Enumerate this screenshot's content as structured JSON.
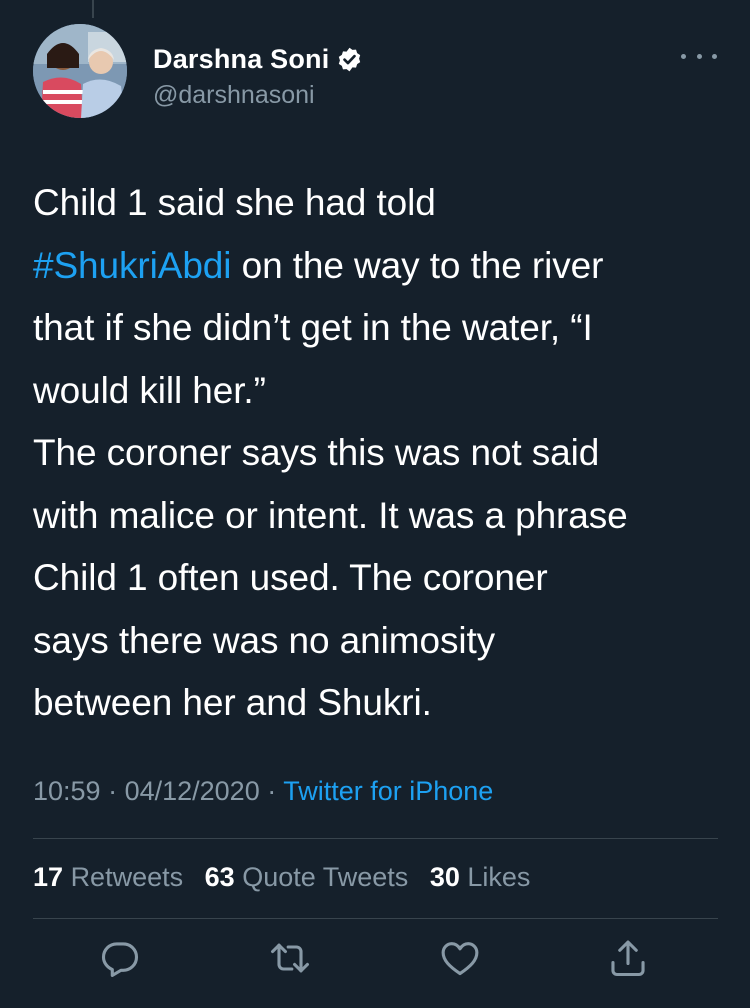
{
  "tweet": {
    "author": {
      "display_name": "Darshna Soni",
      "handle": "@darshnasoni",
      "verified": true
    },
    "text": {
      "line_1": "Child 1 said she had told",
      "hashtag": "#ShukriAbdi",
      "after_hashtag": " on the way to the river",
      "line_3": "that if she didn’t get in the water, “I",
      "line_4": "would kill her.”",
      "line_5": "The coroner says this was not said",
      "line_6": "with malice or intent. It was a phrase",
      "line_7": "Child 1 often used. The coroner",
      "line_8": "says there was no animosity",
      "line_9": "between her and Shukri."
    },
    "time": "10:59",
    "date": "04/12/2020",
    "separator": " · ",
    "source": "Twitter for iPhone",
    "stats": {
      "retweets": {
        "count": "17",
        "label": "Retweets"
      },
      "quote_tweets": {
        "count": "63",
        "label": "Quote Tweets"
      },
      "likes": {
        "count": "30",
        "label": "Likes"
      }
    }
  },
  "icons": [
    "more-icon",
    "verified-icon",
    "reply-icon",
    "retweet-icon",
    "like-icon",
    "share-icon"
  ],
  "colors": {
    "background": "#15202b",
    "accent": "#1da1f2",
    "secondary_text": "#8899a6",
    "divider": "#38444d"
  }
}
